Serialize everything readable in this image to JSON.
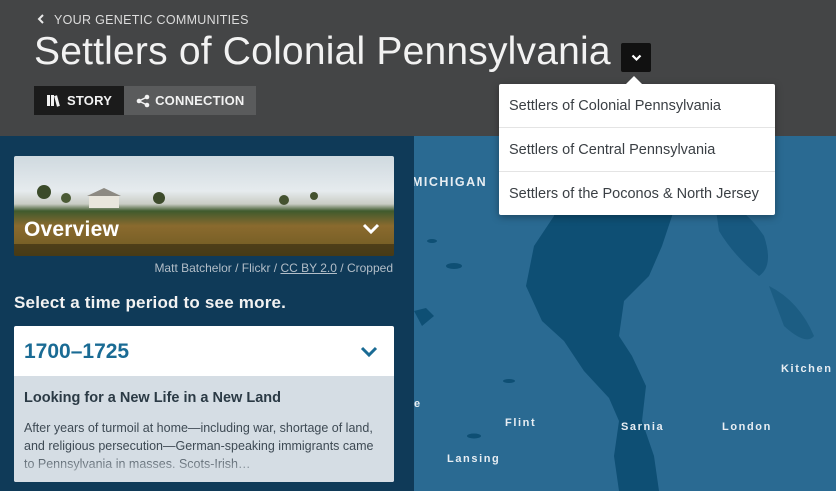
{
  "header": {
    "breadcrumb": "YOUR GENETIC COMMUNITIES",
    "title": "Settlers of Colonial Pennsylvania",
    "tabs": [
      {
        "label": "STORY",
        "icon": "book-icon",
        "active": true
      },
      {
        "label": "CONNECTION",
        "icon": "share-icon",
        "active": false
      }
    ]
  },
  "dropdown": {
    "items": [
      "Settlers of Colonial Pennsylvania",
      "Settlers of Central Pennsylvania",
      "Settlers of the Poconos & North Jersey"
    ]
  },
  "panel": {
    "overview_label": "Overview",
    "credit_prefix": "Matt Batchelor / Flickr / ",
    "credit_license": "CC BY 2.0",
    "credit_suffix": " / Cropped",
    "prompt": "Select a time period to see more.",
    "period": {
      "selected": "1700–1725",
      "heading": "Looking for a New Life in a New Land",
      "body": "After years of turmoil at home—including war, shortage of land, and religious persecution—German-speaking immigrants came to Pennsylvania in masses. Scots-Irish…"
    }
  },
  "map": {
    "labels": {
      "michigan": "MICHIGAN",
      "flint": "Flint",
      "sarnia": "Sarnia",
      "london": "London",
      "lansing": "Lansing",
      "kitchener": "Kitchen",
      "partial": "e"
    }
  },
  "colors": {
    "header_bg": "#444546",
    "panel_bg": "#0f3a58",
    "water": "#0e4f74",
    "land": "#2b6a91",
    "accent_text": "#1a6b94"
  }
}
